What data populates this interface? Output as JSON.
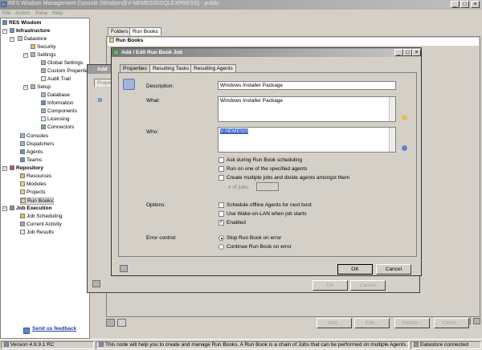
{
  "window": {
    "title": "RES Wisdom Management Console (Wisdom@V-NEMESIS\\SQLEXPRESS) - public"
  },
  "menu": [
    "File",
    "Action",
    "Pane",
    "Help"
  ],
  "tree": {
    "root": "RES Wisdom",
    "infrastructure": "Infrastructure",
    "datastore": "Datastore",
    "security": "Security",
    "settings": "Settings",
    "global_settings": "Global Settings",
    "custom_properties": "Custom Properties",
    "audit_trail": "Audit Trail",
    "setup": "Setup",
    "database": "Database",
    "information": "Information",
    "components": "Components",
    "licensing": "Licensing",
    "connectors": "Connectors",
    "consoles": "Consoles",
    "dispatchers": "Dispatchers",
    "agents": "Agents",
    "teams": "Teams",
    "repository": "Repository",
    "resources": "Resources",
    "modules": "Modules",
    "projects": "Projects",
    "run_books": "Run Books",
    "job_execution": "Job Execution",
    "job_scheduling": "Job Scheduling",
    "current_activity": "Current Activity",
    "job_results": "Job Results"
  },
  "feedback": "Send us feedback",
  "main": {
    "tabs": [
      "Folders",
      "Run Books"
    ],
    "section": "Run Books",
    "buttons": {
      "add": "Add...",
      "edit": "Edit...",
      "delete": "Delete...",
      "clone": "Clone..."
    }
  },
  "back_dialog": {
    "title": "Add",
    "tab": "Proper",
    "ok": "OK",
    "cancel": "Cancel"
  },
  "dialog": {
    "title": "Add / Edit Run Book Job",
    "tabs": [
      "Properties",
      "Resulting Tasks",
      "Resulting Agents"
    ],
    "description_label": "Description:",
    "description_value": "Windows Installer Package",
    "what_label": "What:",
    "what_value": "Windows Installer Package",
    "who_label": "Who:",
    "who_value": "V-NEMESIS",
    "ask_scheduling": "Ask during Run Book scheduling",
    "run_one": "Run on one of the specified agents",
    "create_multiple": "Create multiple jobs and divide agents amongst them",
    "num_jobs_label": "# of jobs:",
    "options_label": "Options:",
    "schedule_offline": "Schedule offline Agents for next boot",
    "wake_on_lan": "Use Wake-on-LAN when job starts",
    "enabled": "Enabled",
    "enabled_checked": true,
    "error_control_label": "Error control:",
    "stop_on_error": "Stop Run Book on error",
    "continue_on_error": "Continue Run Book on error",
    "ok": "OK",
    "cancel": "Cancel"
  },
  "status": {
    "version": "Version 4.9.9.1 RC",
    "message": "This node will help you to create and manage Run Books. A Run Book is a chain of Jobs that can be performed on multiple Agents.",
    "datastore": "Datastore connected"
  }
}
